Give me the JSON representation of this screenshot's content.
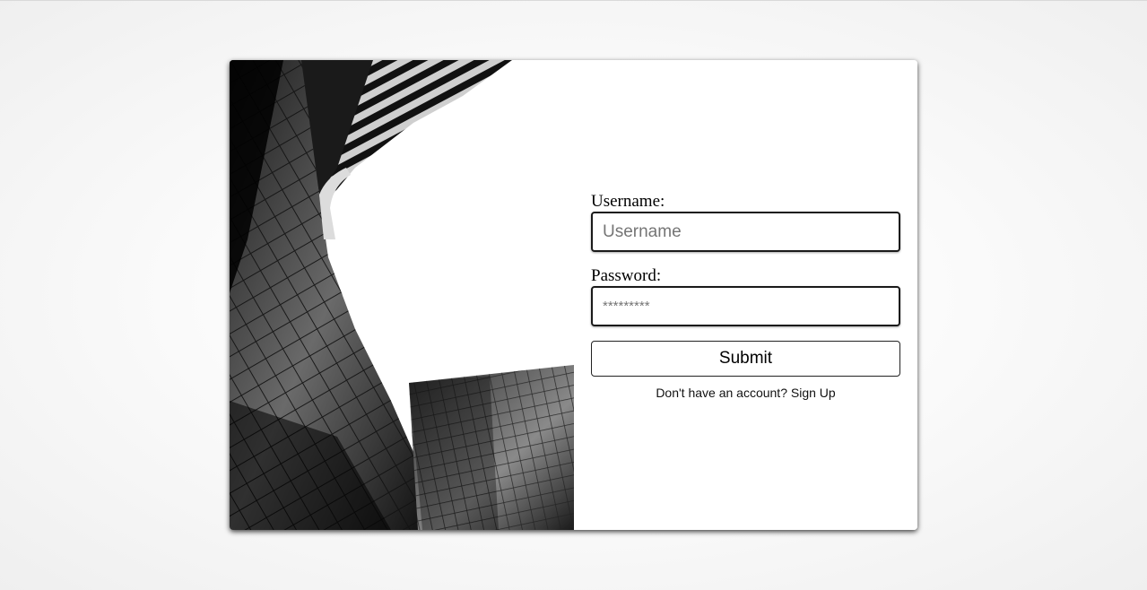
{
  "login": {
    "username_label": "Username:",
    "username_placeholder": "Username",
    "password_label": "Password:",
    "password_placeholder": "*********",
    "submit_label": "Submit",
    "signup_prompt": "Don't have an account?",
    "signup_link": "Sign Up"
  },
  "colors": {
    "page_background": "#f3f3f3",
    "card_background": "#ffffff",
    "border": "#1a1a1a"
  },
  "icons": {
    "hero_image": "building-photo"
  }
}
